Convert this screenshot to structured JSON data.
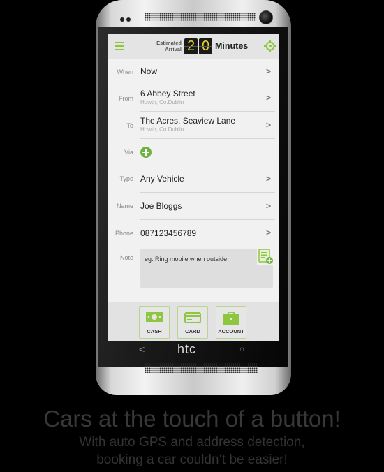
{
  "header": {
    "menu_icon": "hamburger-icon",
    "eta_label_line1": "Estimated",
    "eta_label_line2": "Arrival",
    "eta_digit1": "2",
    "eta_digit2": "0",
    "eta_unit": "Minutes",
    "gps_icon": "crosshair-target-icon"
  },
  "form": {
    "when": {
      "label": "When",
      "value": "Now"
    },
    "from": {
      "label": "From",
      "value": "6 Abbey Street",
      "sub": "Howth, Co.Dublin"
    },
    "to": {
      "label": "To",
      "value": "The Acres, Seaview Lane",
      "sub": "Howth, Co.Dublin"
    },
    "via": {
      "label": "Via",
      "icon": "add-circle-icon"
    },
    "type": {
      "label": "Type",
      "value": "Any Vehicle"
    },
    "name": {
      "label": "Name",
      "value": "Joe Bloggs"
    },
    "phone": {
      "label": "Phone",
      "value": "087123456789"
    },
    "note": {
      "label": "Note",
      "placeholder": "eg. Ring mobile when outside",
      "icon": "add-note-icon"
    },
    "chevron": ">"
  },
  "payment": {
    "cash": "CASH",
    "card": "CARD",
    "account": "ACCOUNT"
  },
  "nav": {
    "back": "<",
    "brand": "htc",
    "home": "⌂"
  },
  "colors": {
    "accent": "#8dc63f",
    "eta_digit": "#e7d62a"
  },
  "tagline": {
    "headline": "Cars at the touch of a button!",
    "line1": "With auto GPS and address detection,",
    "line2": "booking a car couldn’t be easier!"
  }
}
